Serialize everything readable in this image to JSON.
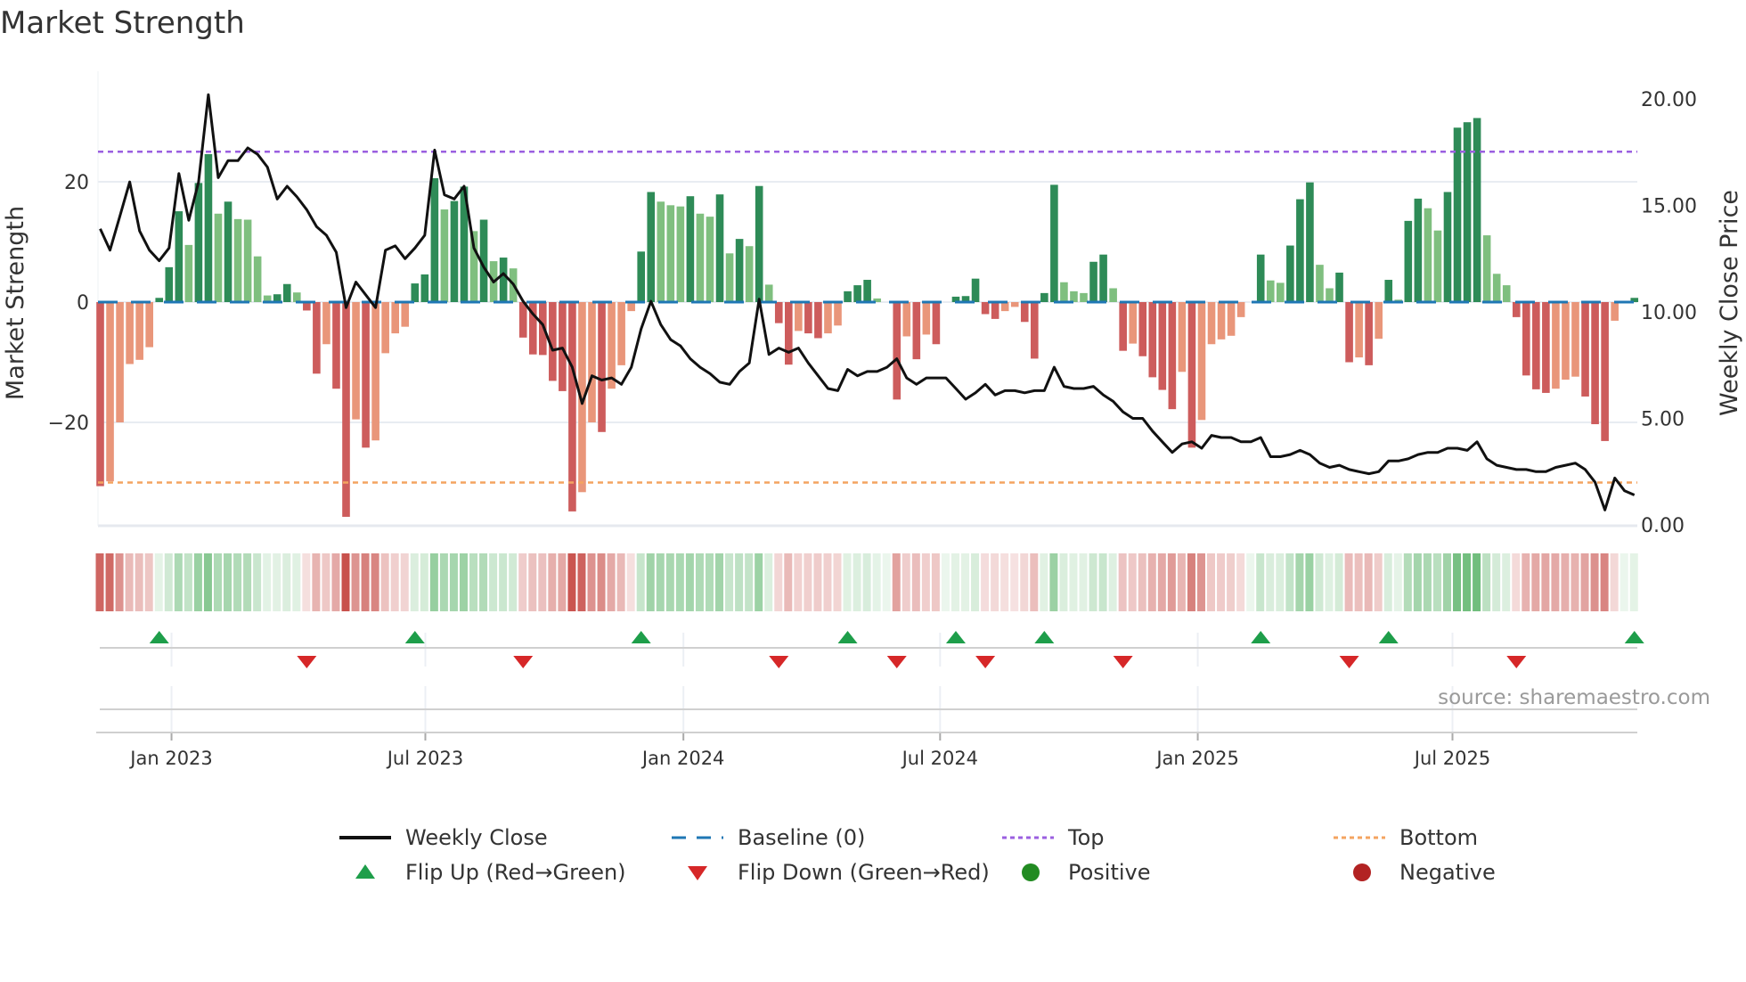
{
  "title": "Market Strength",
  "source": "source: sharemaestro.com",
  "chart_data": {
    "type": "bar",
    "title": "Market Strength",
    "ylabel": "Market Strength",
    "y2label": "Weekly Close Price",
    "ylim": [
      -37,
      38
    ],
    "y2lim": [
      0,
      21.5
    ],
    "yticks": [
      {
        "v": -20,
        "label": "−20"
      },
      {
        "v": 0,
        "label": "0"
      },
      {
        "v": 20,
        "label": "20"
      }
    ],
    "y2ticks": [
      {
        "v": 0,
        "label": "0.00"
      },
      {
        "v": 5,
        "label": "5.00"
      },
      {
        "v": 10,
        "label": "10.00"
      },
      {
        "v": 15,
        "label": "15.00"
      },
      {
        "v": 20,
        "label": "20.00"
      }
    ],
    "xticks": [
      {
        "week_index": 7.25,
        "label": "Jan 2023"
      },
      {
        "week_index": 33.06,
        "label": "Jul 2023"
      },
      {
        "week_index": 59.3,
        "label": "Jan 2024"
      },
      {
        "week_index": 85.4,
        "label": "Jul 2024"
      },
      {
        "week_index": 111.6,
        "label": "Jan 2025"
      },
      {
        "week_index": 137.5,
        "label": "Jul 2025"
      }
    ],
    "top_level": 25,
    "bottom_level": -30,
    "baseline": 0,
    "strength": [
      -30.6,
      -29.8,
      -20,
      -10.3,
      -9.6,
      -7.5,
      0.7,
      5.8,
      15.1,
      9.5,
      19.8,
      24.6,
      14.7,
      16.7,
      13.8,
      13.7,
      7.6,
      1.1,
      1.3,
      3.0,
      1.6,
      -1.4,
      -11.9,
      -7,
      -14.4,
      -35.7,
      -19.5,
      -24.2,
      -23,
      -8.5,
      -5.2,
      -4.1,
      3.1,
      4.6,
      20.6,
      15.4,
      16.8,
      19.2,
      11.8,
      13.7,
      6.8,
      7.4,
      5.6,
      -5.9,
      -8.7,
      -8.8,
      -13.1,
      -14.8,
      -34.8,
      -31.6,
      -20,
      -21.6,
      -14.4,
      -10.5,
      -1.5,
      8.4,
      18.3,
      16.7,
      16.1,
      15.9,
      17.6,
      14.7,
      14.2,
      17.9,
      8.1,
      10.5,
      9.3,
      19.3,
      2.9,
      -3.5,
      -10.4,
      -4.8,
      -5.2,
      -6,
      -5.2,
      -3.9,
      1.8,
      2.8,
      3.7,
      0.6,
      0,
      -16.2,
      -5.7,
      -9.5,
      -5.4,
      -7,
      0,
      0.9,
      1,
      3.9,
      -2,
      -2.8,
      -1.5,
      -0.8,
      -3.3,
      -9.4,
      1.5,
      19.5,
      3.3,
      1.8,
      1.5,
      6.7,
      7.9,
      2.3,
      -8.1,
      -6.9,
      -9,
      -12.5,
      -14.6,
      -17.8,
      -11.6,
      -24.2,
      -19.6,
      -7,
      -6.2,
      -5.6,
      -2.5,
      0,
      7.9,
      3.6,
      3.2,
      9.4,
      17.1,
      19.9,
      6.2,
      2.3,
      4.9,
      -10,
      -9.2,
      -10.5,
      -6.1,
      3.7,
      0.4,
      13.5,
      17.2,
      15.6,
      11.9,
      18.3,
      29,
      29.9,
      30.6,
      11.1,
      4.7,
      2.8,
      -2.5,
      -12.2,
      -14.5,
      -15.1,
      -14.4,
      -12.9,
      -12.4,
      -15.7,
      -20.3,
      -23.1,
      -3.1,
      0,
      0.7
    ],
    "weekly_close": [
      13.9,
      12.9,
      14.5,
      16.1,
      13.8,
      12.9,
      12.4,
      13,
      16.5,
      14.3,
      16.1,
      20.2,
      16.3,
      17.1,
      17.1,
      17.7,
      17.4,
      16.8,
      15.3,
      15.9,
      15.4,
      14.8,
      14,
      13.6,
      12.8,
      10.2,
      11.4,
      10.8,
      10.2,
      12.9,
      13.1,
      12.5,
      13,
      13.6,
      17.6,
      15.5,
      15.3,
      15.9,
      13,
      12.1,
      11.4,
      11.8,
      11.3,
      10.5,
      9.9,
      9.4,
      8.2,
      8.3,
      7.4,
      5.7,
      7,
      6.8,
      6.9,
      6.6,
      7.4,
      9.2,
      10.5,
      9.4,
      8.7,
      8.4,
      7.8,
      7.4,
      7.1,
      6.7,
      6.6,
      7.2,
      7.6,
      10.6,
      8,
      8.3,
      8.1,
      8.3,
      7.6,
      7,
      6.4,
      6.3,
      7.3,
      7,
      7.2,
      7.2,
      7.4,
      7.8,
      6.9,
      6.6,
      6.9,
      6.9,
      6.9,
      6.4,
      5.9,
      6.2,
      6.6,
      6.1,
      6.3,
      6.3,
      6.2,
      6.3,
      6.3,
      7.4,
      6.5,
      6.4,
      6.4,
      6.5,
      6.1,
      5.8,
      5.3,
      5,
      5,
      4.4,
      3.9,
      3.4,
      3.8,
      3.9,
      3.6,
      4.2,
      4.1,
      4.1,
      3.9,
      3.9,
      4.1,
      3.2,
      3.2,
      3.3,
      3.5,
      3.3,
      2.9,
      2.7,
      2.8,
      2.6,
      2.5,
      2.4,
      2.5,
      3,
      3,
      3.1,
      3.3,
      3.4,
      3.4,
      3.6,
      3.6,
      3.5,
      3.9,
      3.1,
      2.8,
      2.7,
      2.6,
      2.6,
      2.5,
      2.5,
      2.7,
      2.8,
      2.9,
      2.6,
      2,
      0.7,
      2.2,
      1.6,
      1.4
    ],
    "legend": [
      {
        "key": "close",
        "label": "Weekly Close"
      },
      {
        "key": "baseline",
        "label": "Baseline (0)"
      },
      {
        "key": "top",
        "label": "Top"
      },
      {
        "key": "bottom",
        "label": "Bottom"
      },
      {
        "key": "flip_up",
        "label": "Flip Up (Red→Green)"
      },
      {
        "key": "flip_down",
        "label": "Flip Down (Green→Red)"
      },
      {
        "key": "positive",
        "label": "Positive"
      },
      {
        "key": "negative",
        "label": "Negative"
      }
    ],
    "legend_placement": "bottom",
    "colors": {
      "pos_strong": "#2e8b57",
      "pos_weak": "#7fbf7f",
      "neg_strong": "#cd5c5c",
      "neg_weak": "#e9967a",
      "close": "#111111",
      "baseline": "#1f77b4",
      "top": "#9b5fe0",
      "bottom": "#f4a460",
      "flip_up": "#1e9e4a",
      "flip_down": "#d62728",
      "positive": "#228b22",
      "negative": "#b22222"
    }
  }
}
